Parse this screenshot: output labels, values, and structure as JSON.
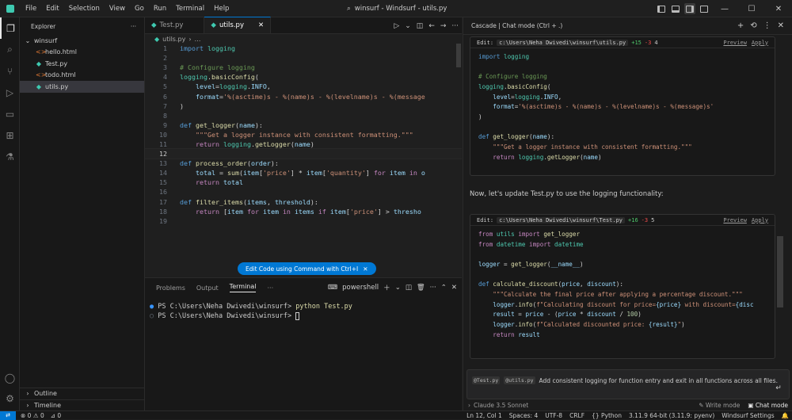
{
  "menu": [
    "File",
    "Edit",
    "Selection",
    "View",
    "Go",
    "Run",
    "Terminal",
    "Help"
  ],
  "window_title": "winsurf - Windsurf - utils.py",
  "explorer": {
    "title": "Explorer",
    "folder": "winsurf",
    "files": [
      {
        "name": "hello.html",
        "icon": "html-icon",
        "color": "#e37933",
        "glyph": "<>"
      },
      {
        "name": "Test.py",
        "icon": "python-icon",
        "color": "#3ec9b0",
        "glyph": "◆"
      },
      {
        "name": "todo.html",
        "icon": "html-icon",
        "color": "#e37933",
        "glyph": "<>"
      },
      {
        "name": "utils.py",
        "icon": "python-icon",
        "color": "#3ec9b0",
        "glyph": "◆"
      }
    ],
    "outline": "Outline",
    "timeline": "Timeline"
  },
  "tabs": [
    {
      "label": "Test.py",
      "active": false
    },
    {
      "label": "utils.py",
      "active": true
    }
  ],
  "breadcrumb": {
    "file": "utils.py",
    "sep": "›",
    "more": "…"
  },
  "editor_lines": [
    {
      "n": "1",
      "html": "<span class='kw'>import</span> <span class='cls'>logging</span>"
    },
    {
      "n": "2",
      "html": ""
    },
    {
      "n": "3",
      "html": "<span class='cm'># Configure logging</span>"
    },
    {
      "n": "4",
      "html": "<span class='cls'>logging</span>.<span class='fn'>basicConfig</span>("
    },
    {
      "n": "5",
      "html": "    <span class='var'>level</span>=<span class='cls'>logging</span>.<span class='var'>INFO</span>,"
    },
    {
      "n": "6",
      "html": "    <span class='var'>format</span>=<span class='str'>'%(asctime)s - %(name)s - %(levelname)s - %(message</span>"
    },
    {
      "n": "7",
      "html": ")"
    },
    {
      "n": "8",
      "html": ""
    },
    {
      "n": "9",
      "html": "<span class='kw'>def</span> <span class='fn'>get_logger</span>(<span class='var'>name</span>):"
    },
    {
      "n": "10",
      "html": "    <span class='str'>\"\"\"Get a logger instance with consistent formatting.\"\"\"</span>"
    },
    {
      "n": "11",
      "html": "    <span class='kw2'>return</span> <span class='cls'>logging</span>.<span class='fn'>getLogger</span>(<span class='var'>name</span>)"
    },
    {
      "n": "12",
      "html": "",
      "cur": true
    },
    {
      "n": "13",
      "html": "<span class='kw'>def</span> <span class='fn'>process_order</span>(<span class='var'>order</span>):"
    },
    {
      "n": "14",
      "html": "    <span class='var'>total</span> = <span class='fn'>sum</span>(<span class='var'>item</span>[<span class='str'>'price'</span>] * <span class='var'>item</span>[<span class='str'>'quantity'</span>] <span class='kw2'>for</span> <span class='var'>item</span> <span class='kw2'>in</span> <span class='var'>o</span>"
    },
    {
      "n": "15",
      "html": "    <span class='kw2'>return</span> <span class='var'>total</span>"
    },
    {
      "n": "16",
      "html": ""
    },
    {
      "n": "17",
      "html": "<span class='kw'>def</span> <span class='fn'>filter_items</span>(<span class='var'>items</span>, <span class='var'>threshold</span>):"
    },
    {
      "n": "18",
      "html": "    <span class='kw2'>return</span> [<span class='var'>item</span> <span class='kw2'>for</span> <span class='var'>item</span> <span class='kw2'>in</span> <span class='var'>items</span> <span class='kw2'>if</span> <span class='var'>item</span>[<span class='str'>'price'</span>] &gt; <span class='var'>thresho</span>"
    },
    {
      "n": "19",
      "html": ""
    }
  ],
  "edit_code_button": "Edit Code using Command with Ctrl+I",
  "panel": {
    "tabs": [
      "Problems",
      "Output",
      "Terminal"
    ],
    "active_tab": "Terminal",
    "more": "···",
    "shell": "powershell",
    "lines": [
      {
        "prompt": "PS C:\\Users\\Neha Dwivedi\\winsurf>",
        "cmd": "python Test.py"
      },
      {
        "prompt": "PS C:\\Users\\Neha Dwivedi\\winsurf>",
        "cmd": ""
      }
    ]
  },
  "cascade": {
    "title": "Cascade | Chat mode (Ctrl + .)",
    "diff1": {
      "label": "Edit:",
      "path": "c:\\Users\\Neha Dwivedi\\winsurf\\utils.py",
      "add": "+15",
      "del": "-3",
      "count": "4",
      "preview": "Preview",
      "apply": "Apply",
      "lines": [
        "<span class='kw'>import</span> <span class='cls'>logging</span>",
        "",
        "<span class='cm'># Configure logging</span>",
        "<span class='cls'>logging</span>.<span class='fn'>basicConfig</span>(",
        "    <span class='var'>level</span>=<span class='cls'>logging</span>.<span class='var'>INFO</span>,",
        "    <span class='var'>format</span>=<span class='str'>'%(asctime)s - %(name)s - %(levelname)s - %(message)s'</span>",
        ")",
        "",
        "<span class='kw'>def</span> <span class='fn'>get_logger</span>(<span class='var'>name</span>):",
        "    <span class='str'>\"\"\"Get a logger instance with consistent formatting.\"\"\"</span>",
        "    <span class='kw2'>return</span> <span class='cls'>logging</span>.<span class='fn'>getLogger</span>(<span class='var'>name</span>)"
      ]
    },
    "message": "Now, let's update Test.py to use the logging functionality:",
    "diff2": {
      "label": "Edit:",
      "path": "c:\\Users\\Neha Dwivedi\\winsurf\\Test.py",
      "add": "+16",
      "del": "-3",
      "count": "5",
      "preview": "Preview",
      "apply": "Apply",
      "lines": [
        "<span class='kw2'>from</span> <span class='cls'>utils</span> <span class='kw2'>import</span> <span class='fn'>get_logger</span>",
        "<span class='kw2'>from</span> <span class='cls'>datetime</span> <span class='kw2'>import</span> <span class='cls'>datetime</span>",
        "",
        "<span class='var'>logger</span> = <span class='fn'>get_logger</span>(<span class='var'>__name__</span>)",
        "",
        "<span class='kw'>def</span> <span class='fn'>calculate_discount</span>(<span class='var'>price</span>, <span class='var'>discount</span>):",
        "    <span class='str'>\"\"\"Calculate the final price after applying a percentage discount.\"\"\"</span>",
        "    <span class='var'>logger</span>.<span class='fn'>info</span>(<span class='str'>f\"Calculating discount for price=</span><span class='var'>{price}</span><span class='str'> with discount=</span><span class='var'>{disc</span>",
        "    <span class='var'>result</span> = <span class='var'>price</span> - (<span class='var'>price</span> * <span class='var'>discount</span> / <span class='num'>100</span>)",
        "    <span class='var'>logger</span>.<span class='fn'>info</span>(<span class='str'>f\"Calculated discounted price: </span><span class='var'>{result}</span><span class='str'>\"</span>)",
        "    <span class='kw2'>return</span> <span class='var'>result</span>"
      ]
    },
    "input": {
      "chip1": "@Test.py",
      "chip2": "@utils.py",
      "text": "Add consistent logging for function entry and exit in all functions across all files."
    },
    "model": "Claude 3.5 Sonnet",
    "write_mode": "Write mode",
    "chat_mode": "Chat mode"
  },
  "statusbar": {
    "remote": "⇄",
    "errors": "0",
    "warnings": "0",
    "ports": "0",
    "position": "Ln 12, Col 1",
    "spaces": "Spaces: 4",
    "encoding": "UTF-8",
    "eol": "CRLF",
    "language": "Python",
    "interpreter": "3.11.9 64-bit (3.11.9: pyenv)",
    "settings": "Windsurf Settings"
  }
}
